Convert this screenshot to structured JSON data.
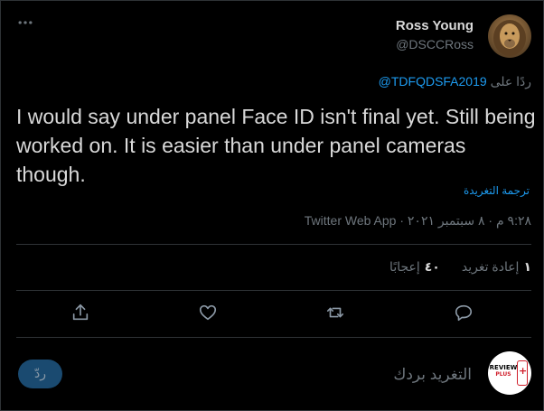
{
  "author": {
    "name": "Ross Young",
    "handle": "@DSCCRoss"
  },
  "reply_context": {
    "prefix": "ردًا على",
    "handle": "@TDFQDSFA2019"
  },
  "tweet": {
    "text": "I would say under panel Face ID isn't final yet. Still being worked on. It is easier than under panel cameras though.",
    "translate_label": "ترجمة التغريدة"
  },
  "meta": {
    "time": "٩:٢٨ م",
    "date": "٨ سبتمبر ٢٠٢١",
    "separator": "·",
    "app": "Twitter Web App"
  },
  "stats": {
    "retweets": {
      "count": "١",
      "label": "إعادة تغريد"
    },
    "likes": {
      "count": "٤٠",
      "label": "إعجابًا"
    }
  },
  "compose": {
    "placeholder": "التغريد بردك",
    "reply_button": "ردّ"
  },
  "logo": {
    "top": "REVIEW",
    "bottom": "PLUS"
  },
  "colors": {
    "background": "#000000",
    "text": "#d9d9d9",
    "secondary": "#6e767d",
    "accent": "#1d9bf0",
    "border": "#2f3336"
  }
}
